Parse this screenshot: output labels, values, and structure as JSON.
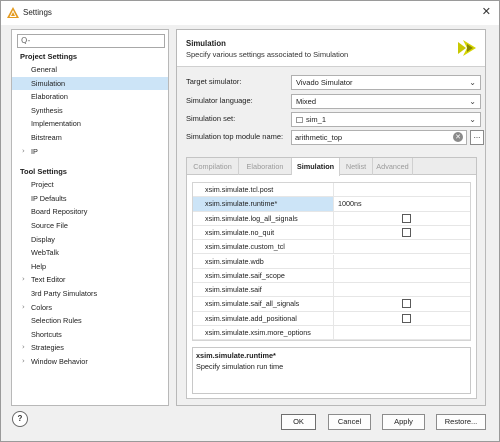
{
  "window": {
    "title": "Settings",
    "close_glyph": "✕"
  },
  "sidebar": {
    "search_placeholder": "Q-",
    "sections": [
      {
        "header": "Project Settings",
        "items": [
          {
            "label": "General"
          },
          {
            "label": "Simulation",
            "selected": true
          },
          {
            "label": "Elaboration"
          },
          {
            "label": "Synthesis"
          },
          {
            "label": "Implementation"
          },
          {
            "label": "Bitstream"
          },
          {
            "label": "IP",
            "expandable": true
          }
        ]
      },
      {
        "header": "Tool Settings",
        "items": [
          {
            "label": "Project"
          },
          {
            "label": "IP Defaults"
          },
          {
            "label": "Board Repository"
          },
          {
            "label": "Source File"
          },
          {
            "label": "Display"
          },
          {
            "label": "WebTalk"
          },
          {
            "label": "Help"
          },
          {
            "label": "Text Editor",
            "expandable": true
          },
          {
            "label": "3rd Party Simulators"
          },
          {
            "label": "Colors",
            "expandable": true
          },
          {
            "label": "Selection Rules"
          },
          {
            "label": "Shortcuts"
          },
          {
            "label": "Strategies",
            "expandable": true
          },
          {
            "label": "Window Behavior",
            "expandable": true
          }
        ]
      }
    ]
  },
  "header": {
    "title": "Simulation",
    "subtitle": "Specify various settings associated to Simulation"
  },
  "form": {
    "target_label": "Target simulator:",
    "target_value": "Vivado Simulator",
    "language_label": "Simulator language:",
    "language_value": "Mixed",
    "set_label": "Simulation set:",
    "set_value": "sim_1",
    "top_label": "Simulation top module name:",
    "top_value": "arithmetic_top",
    "browse_label": "...",
    "clear_glyph": "✕",
    "chevron": "⌄"
  },
  "tabs": [
    {
      "label": "Compilation"
    },
    {
      "label": "Elaboration"
    },
    {
      "label": "Simulation",
      "active": true
    },
    {
      "label": "Netlist"
    },
    {
      "label": "Advanced"
    }
  ],
  "properties": [
    {
      "key": "xsim.simulate.tcl.post",
      "value": ""
    },
    {
      "key": "xsim.simulate.runtime*",
      "value": "1000ns",
      "selected": true
    },
    {
      "key": "xsim.simulate.log_all_signals",
      "checkbox": true,
      "checked": false
    },
    {
      "key": "xsim.simulate.no_quit",
      "checkbox": true,
      "checked": false
    },
    {
      "key": "xsim.simulate.custom_tcl",
      "value": ""
    },
    {
      "key": "xsim.simulate.wdb",
      "value": ""
    },
    {
      "key": "xsim.simulate.saif_scope",
      "value": ""
    },
    {
      "key": "xsim.simulate.saif",
      "value": ""
    },
    {
      "key": "xsim.simulate.saif_all_signals",
      "checkbox": true,
      "checked": false
    },
    {
      "key": "xsim.simulate.add_positional",
      "checkbox": true,
      "checked": false
    },
    {
      "key": "xsim.simulate.xsim.more_options",
      "value": ""
    }
  ],
  "description": {
    "title": "xsim.simulate.runtime*",
    "text": "Specify simulation run time"
  },
  "footer": {
    "help": "?",
    "ok": "OK",
    "cancel": "Cancel",
    "apply": "Apply",
    "restore": "Restore..."
  },
  "colors": {
    "selection": "#cce4f7",
    "logo": "#c8c800"
  },
  "icons": {
    "app": "vivado-logo-icon",
    "search": "search-icon",
    "folder": "folder-icon"
  }
}
